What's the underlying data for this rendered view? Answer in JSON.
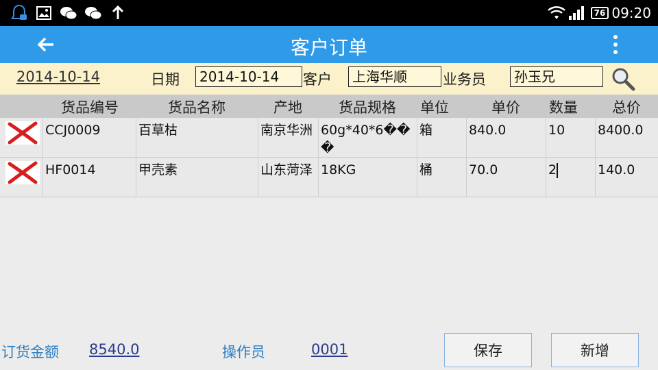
{
  "status_bar": {
    "time": "09:20",
    "battery": "76"
  },
  "app_bar": {
    "title": "客户订单"
  },
  "filter": {
    "date_link": "2014-10-14",
    "date_label": "日期",
    "date_value": "2014-10-14",
    "customer_label": "客户",
    "customer_value": "上海华顺",
    "salesman_label": "业务员",
    "salesman_value": "孙玉兄"
  },
  "table": {
    "columns": [
      "货品编号",
      "货品名称",
      "产地",
      "货品规格",
      "单位",
      "单价",
      "数量",
      "总价"
    ],
    "rows": [
      {
        "code": "CCJ0009",
        "name": "百草枯",
        "origin": "南京华洲",
        "spec": "60g*40*6��\n�",
        "unit": "箱",
        "price": "840.0",
        "qty": "10",
        "total": "8400.0"
      },
      {
        "code": "HF0014",
        "name": "甲壳素",
        "origin": "山东菏泽",
        "spec": "18KG",
        "unit": "桶",
        "price": "70.0",
        "qty": "2",
        "total": "140.0"
      }
    ]
  },
  "footer": {
    "order_amount_label": "订货金额",
    "order_amount_value": "8540.0",
    "operator_label": "操作员",
    "operator_value": "0001",
    "save_label": "保存",
    "add_label": "新增"
  },
  "colors": {
    "app_bar": "#2f9ae8",
    "filter_bar": "#fbf2cc",
    "header_row": "#c9c9c9",
    "accent_text": "#2f7fc2"
  }
}
